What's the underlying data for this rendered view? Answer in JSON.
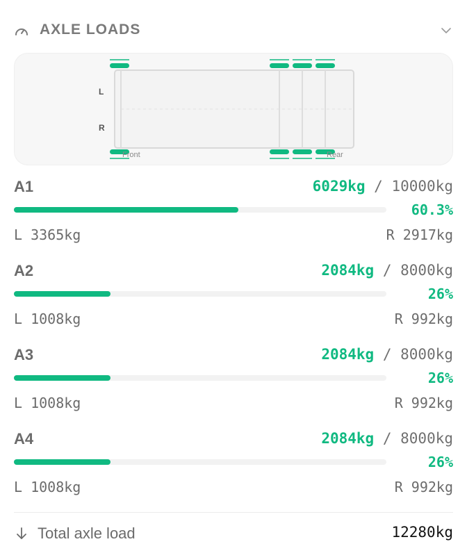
{
  "header": {
    "title": "AXLE LOADS",
    "icon": "gauge-icon",
    "collapse_icon": "chevron-down-icon"
  },
  "diagram": {
    "side_left_label": "L",
    "side_right_label": "R",
    "front_label": "Front",
    "rear_label": "Rear",
    "tire_color": "#10b981"
  },
  "axles": [
    {
      "name": "A1",
      "load": "6029kg",
      "separator": "/",
      "max": "10000kg",
      "percent": "60.3%",
      "fraction": 0.603,
      "left": "L 3365kg",
      "right": "R 2917kg"
    },
    {
      "name": "A2",
      "load": "2084kg",
      "separator": "/",
      "max": "8000kg",
      "percent": "26%",
      "fraction": 0.26,
      "left": "L 1008kg",
      "right": "R 992kg"
    },
    {
      "name": "A3",
      "load": "2084kg",
      "separator": "/",
      "max": "8000kg",
      "percent": "26%",
      "fraction": 0.26,
      "left": "L 1008kg",
      "right": "R 992kg"
    },
    {
      "name": "A4",
      "load": "2084kg",
      "separator": "/",
      "max": "8000kg",
      "percent": "26%",
      "fraction": 0.26,
      "left": "L 1008kg",
      "right": "R 992kg"
    }
  ],
  "total": {
    "label": "Total axle load",
    "value": "12280kg",
    "icon": "arrow-down-icon"
  },
  "colors": {
    "accent": "#10b981",
    "track": "#f2f2f2"
  }
}
